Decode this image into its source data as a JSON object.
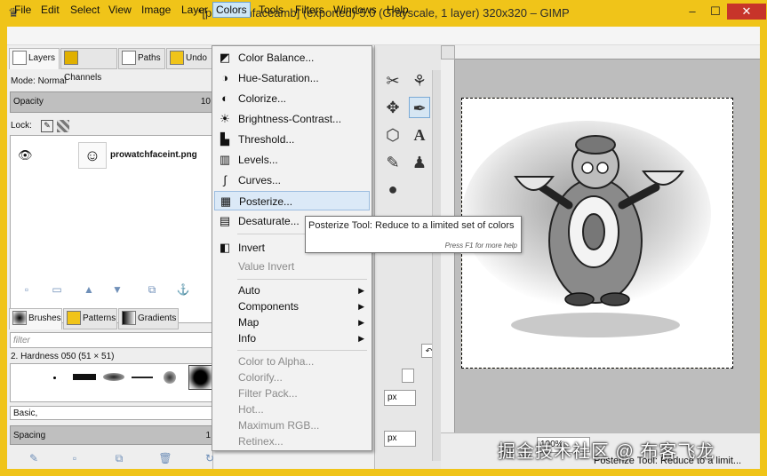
{
  "window": {
    "title": "*[prowatchfaceamb] (exported)-5.0 (Grayscale, 1 layer) 320x320 – GIMP",
    "minimize": "–",
    "maximize": "☐",
    "close": "✕"
  },
  "menubar": [
    "File",
    "Edit",
    "Select",
    "View",
    "Image",
    "Layer",
    "Colors",
    "Tools",
    "Filters",
    "Windows",
    "Help"
  ],
  "layers_dock": {
    "tabs": [
      "Layers",
      "Channels",
      "Paths",
      "Undo"
    ],
    "mode_label": "Mode: Normal",
    "opacity_label": "Opacity",
    "opacity_value": "10",
    "lock_label": "Lock:",
    "layer_name": "prowatchfaceint.png"
  },
  "brushes_dock": {
    "tabs": [
      "Brushes",
      "Patterns",
      "Gradients"
    ],
    "filter_placeholder": "filter",
    "brush_label": "2. Hardness 050 (51 × 51)",
    "preset_label": "Basic,",
    "spacing_label": "Spacing",
    "spacing_value": "1"
  },
  "colors_menu": {
    "items": [
      {
        "label": "Color Balance...",
        "icon": "color-balance-icon",
        "glyph": "◩",
        "enabled": true
      },
      {
        "label": "Hue-Saturation...",
        "icon": "hue-saturation-icon",
        "glyph": "◑",
        "enabled": true
      },
      {
        "label": "Colorize...",
        "icon": "colorize-icon",
        "glyph": "◐",
        "enabled": true
      },
      {
        "label": "Brightness-Contrast...",
        "icon": "brightness-contrast-icon",
        "glyph": "☀",
        "enabled": true
      },
      {
        "label": "Threshold...",
        "icon": "threshold-icon",
        "glyph": "▙",
        "enabled": true
      },
      {
        "label": "Levels...",
        "icon": "levels-icon",
        "glyph": "▥",
        "enabled": true
      },
      {
        "label": "Curves...",
        "icon": "curves-icon",
        "glyph": "∫",
        "enabled": true
      },
      {
        "label": "Posterize...",
        "icon": "posterize-icon",
        "glyph": "▦",
        "enabled": true,
        "hover": true
      },
      {
        "label": "Desaturate...",
        "icon": "desaturate-icon",
        "glyph": "▤",
        "enabled": true
      },
      {
        "label": "Invert",
        "icon": "invert-icon",
        "glyph": "◧",
        "enabled": true
      },
      {
        "label": "Value Invert",
        "icon": "",
        "glyph": "",
        "enabled": false
      },
      {
        "label": "Auto",
        "submenu": true,
        "enabled": true
      },
      {
        "label": "Components",
        "submenu": true,
        "enabled": true
      },
      {
        "label": "Map",
        "submenu": true,
        "enabled": true
      },
      {
        "label": "Info",
        "submenu": true,
        "enabled": true
      },
      {
        "label": "Color to Alpha...",
        "enabled": false
      },
      {
        "label": "Colorify...",
        "enabled": false
      },
      {
        "label": "Filter Pack...",
        "enabled": false
      },
      {
        "label": "Hot...",
        "enabled": false
      },
      {
        "label": "Maximum RGB...",
        "enabled": false
      },
      {
        "label": "Retinex...",
        "enabled": false
      }
    ]
  },
  "tooltip": {
    "text": "Posterize Tool: Reduce to a limited set of colors",
    "help": "Press F1 for more help"
  },
  "toolbox": {
    "units": [
      "px",
      "px"
    ]
  },
  "status": {
    "zoom": "100%",
    "text": "Posterize Tool: Reduce to a limit..."
  },
  "watermark": "掘金技术社区 @ 布客飞龙",
  "colors": {
    "titlebar": "#f0c419",
    "menu_hover": "#dbe9f7"
  }
}
